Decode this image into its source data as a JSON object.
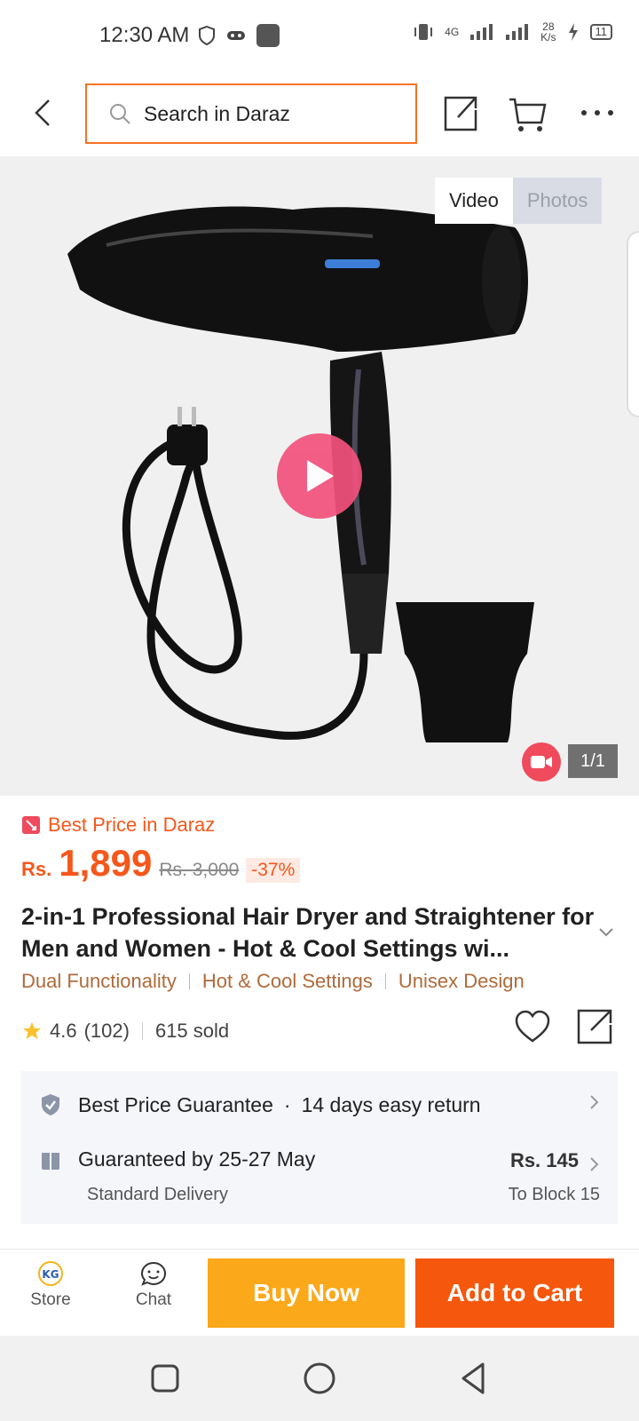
{
  "status_bar": {
    "time": "12:30 AM",
    "network_label": "4G",
    "speed_value": "28",
    "speed_unit": "K/s",
    "battery": "11"
  },
  "header": {
    "search_placeholder": "Search in Daraz"
  },
  "media": {
    "tabs": [
      {
        "label": "Video",
        "active": true
      },
      {
        "label": "Photos",
        "active": false
      }
    ],
    "counter": "1/1"
  },
  "product": {
    "badge": "Best Price in Daraz",
    "currency": "Rs.",
    "price": "1,899",
    "original_price": "Rs. 3,000",
    "discount": "-37%",
    "title": "2-in-1 Professional Hair Dryer and Straightener for Men and Women - Hot & Cool Settings wi...",
    "tags": [
      "Dual Functionality",
      "Hot & Cool Settings",
      "Unisex Design"
    ],
    "rating": "4.6",
    "reviews": "(102)",
    "sold": "615 sold"
  },
  "service": {
    "guarantee": "Best Price Guarantee",
    "separator": "·",
    "return_policy": "14 days easy return",
    "delivery": "Guaranteed by 25-27 May",
    "delivery_type": "Standard Delivery",
    "fee": "Rs. 145",
    "destination": "To Block 15"
  },
  "actions": {
    "store": "Store",
    "chat": "Chat",
    "buy_now": "Buy Now",
    "add_to_cart": "Add to Cart"
  },
  "colors": {
    "accent": "#f5571b",
    "buy_now": "#fba81a",
    "add_to_cart": "#f5570c",
    "play": "#f2517d"
  }
}
